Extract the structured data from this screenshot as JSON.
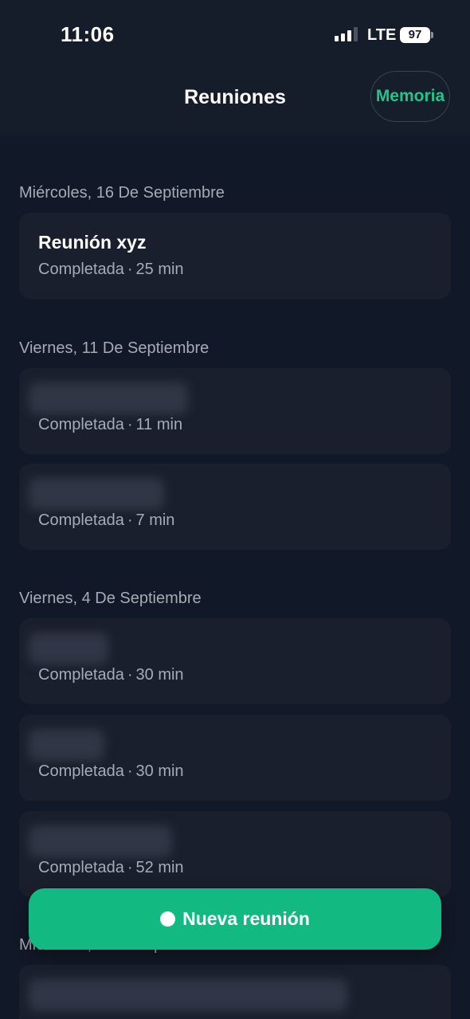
{
  "status_bar": {
    "time": "11:06",
    "network": "LTE",
    "battery": "97",
    "signal_bars_active": 3,
    "signal_bars_total": 4
  },
  "header": {
    "title": "Reuniones",
    "memory_button": "Memoria"
  },
  "groups": [
    {
      "date": "Miércoles, 16 De Septiembre",
      "meetings": [
        {
          "title": "Reunión xyz",
          "status": "Completada",
          "duration": "25 min"
        }
      ]
    },
    {
      "date": "Viernes, 11 De Septiembre",
      "meetings": [
        {
          "title": "",
          "status": "Completada",
          "duration": "11 min"
        },
        {
          "title": "",
          "status": "Completada",
          "duration": "7 min"
        }
      ]
    },
    {
      "date": "Viernes, 4 De Septiembre",
      "meetings": [
        {
          "title": "",
          "status": "Completada",
          "duration": "30 min"
        },
        {
          "title": "",
          "status": "Completada",
          "duration": "30 min"
        },
        {
          "title": "",
          "status": "Completada",
          "duration": "52 min"
        }
      ]
    },
    {
      "date": "Miércoles, 2 De Septiembre",
      "meetings": [
        {
          "title": "",
          "status": "",
          "duration": ""
        }
      ]
    }
  ],
  "separator": "·",
  "new_meeting_button": "Nueva reunión",
  "colors": {
    "accent": "#12b981",
    "memory_text": "#22c48a",
    "background": "#111827",
    "card": "#1a1f2d"
  }
}
